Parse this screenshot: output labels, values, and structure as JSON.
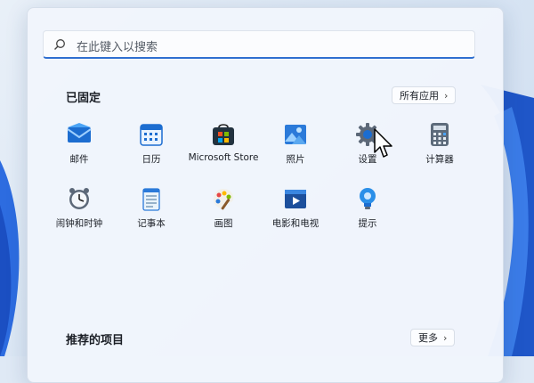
{
  "search": {
    "placeholder": "在此键入以搜索"
  },
  "pinned": {
    "title": "已固定",
    "all_apps_label": "所有应用",
    "apps": [
      {
        "label": "邮件",
        "icon": "mail-icon"
      },
      {
        "label": "日历",
        "icon": "calendar-icon"
      },
      {
        "label": "Microsoft Store",
        "icon": "store-icon"
      },
      {
        "label": "照片",
        "icon": "photos-icon"
      },
      {
        "label": "设置",
        "icon": "gear-icon"
      },
      {
        "label": "计算器",
        "icon": "calculator-icon"
      },
      {
        "label": "闹钟和时钟",
        "icon": "clock-icon"
      },
      {
        "label": "记事本",
        "icon": "notepad-icon"
      },
      {
        "label": "画图",
        "icon": "paint-icon"
      },
      {
        "label": "电影和电视",
        "icon": "film-icon"
      },
      {
        "label": "提示",
        "icon": "lightbulb-icon"
      }
    ]
  },
  "recommended": {
    "title": "推荐的项目",
    "more_label": "更多"
  },
  "colors": {
    "accent": "#2f6fd0",
    "menu_bg": "#f1f5fc"
  }
}
